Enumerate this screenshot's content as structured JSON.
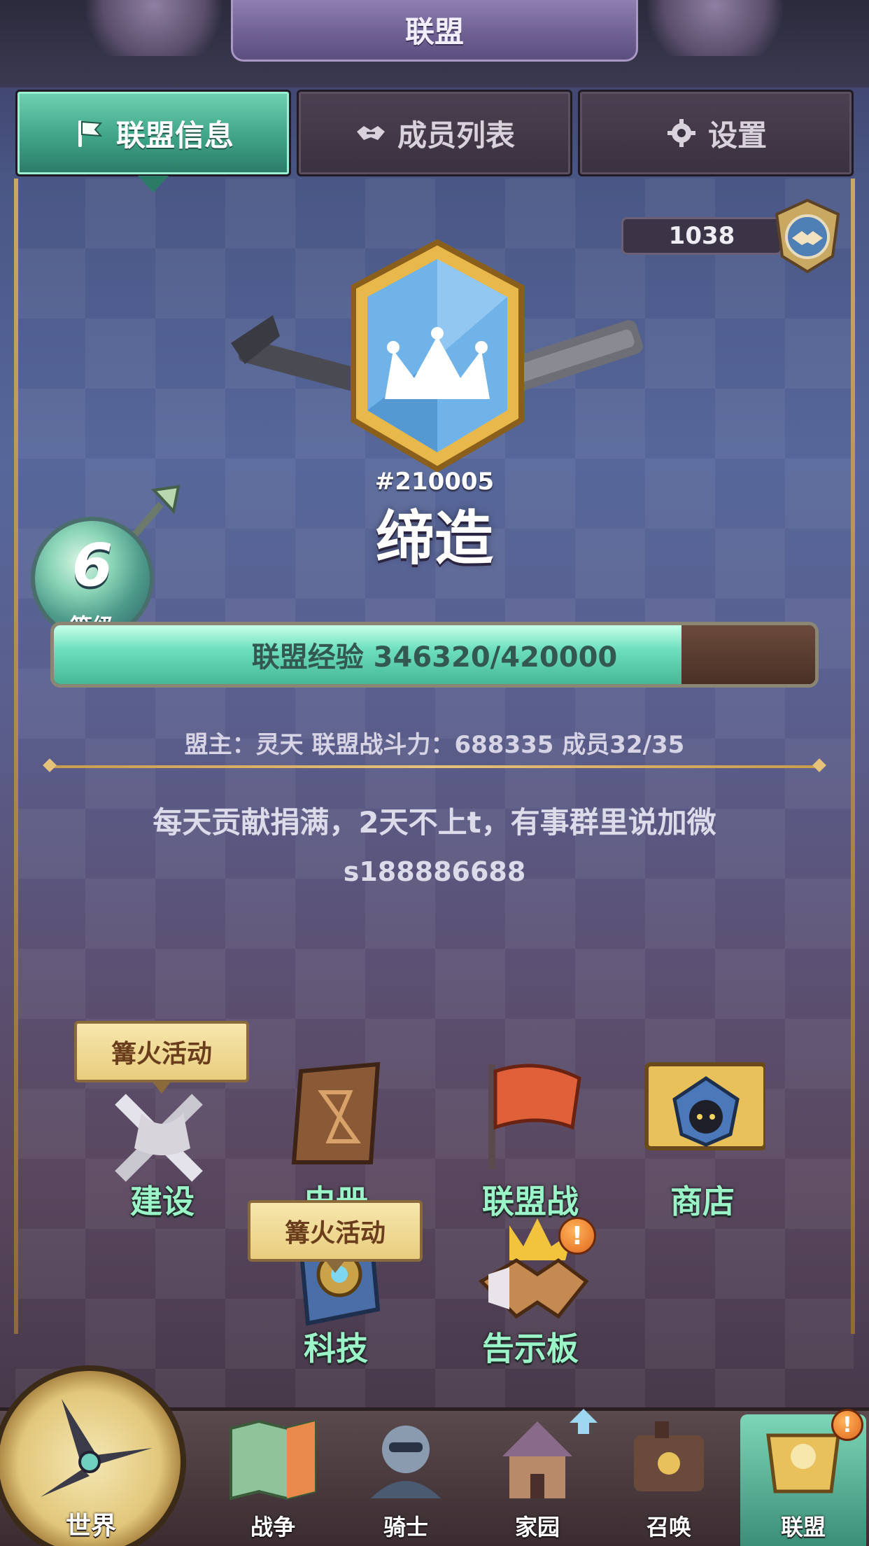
{
  "header": {
    "title": "联盟"
  },
  "tabs": [
    {
      "label": "联盟信息",
      "icon": "flag-icon",
      "active": true
    },
    {
      "label": "成员列表",
      "icon": "handshake-icon",
      "active": false
    },
    {
      "label": "设置",
      "icon": "gear-icon",
      "active": false
    }
  ],
  "score": {
    "value": "1038",
    "badge_icon": "alliance-emblem-icon"
  },
  "alliance": {
    "id": "#210005",
    "name": "缔造",
    "emblem_icon": "crown-icon",
    "level": "6",
    "level_label": "等级",
    "exp_text": "联盟经验 346320/420000",
    "exp_current": 346320,
    "exp_max": 420000,
    "info_line": "盟主：灵天  联盟战斗力：688335 成员32/35",
    "notice_line1": "每天贡献捐满，2天不上t，有事群里说加微",
    "notice_line2": "s188886688"
  },
  "features": [
    {
      "label": "建设",
      "icon": "construction-icon",
      "tag": "篝火活动"
    },
    {
      "label": "史册",
      "icon": "book-icon",
      "tag": ""
    },
    {
      "label": "联盟战",
      "icon": "war-flag-icon",
      "tag": ""
    },
    {
      "label": "商店",
      "icon": "shop-icon",
      "tag": ""
    },
    {
      "label": "科技",
      "icon": "tech-gear-icon",
      "tag": "篝火活动"
    },
    {
      "label": "告示板",
      "icon": "handshake-board-icon",
      "tag": "",
      "alert": "!"
    }
  ],
  "nav": {
    "world": "世界",
    "items": [
      {
        "label": "战争",
        "icon": "war-map-icon"
      },
      {
        "label": "骑士",
        "icon": "knight-icon"
      },
      {
        "label": "家园",
        "icon": "home-icon"
      },
      {
        "label": "召唤",
        "icon": "train-icon"
      },
      {
        "label": "联盟",
        "icon": "alliance-icon",
        "active": true,
        "alert": "!"
      }
    ]
  },
  "colors": {
    "accent": "#6fe0bf",
    "label": "#9bf3c8",
    "gold": "#e6c27b"
  }
}
